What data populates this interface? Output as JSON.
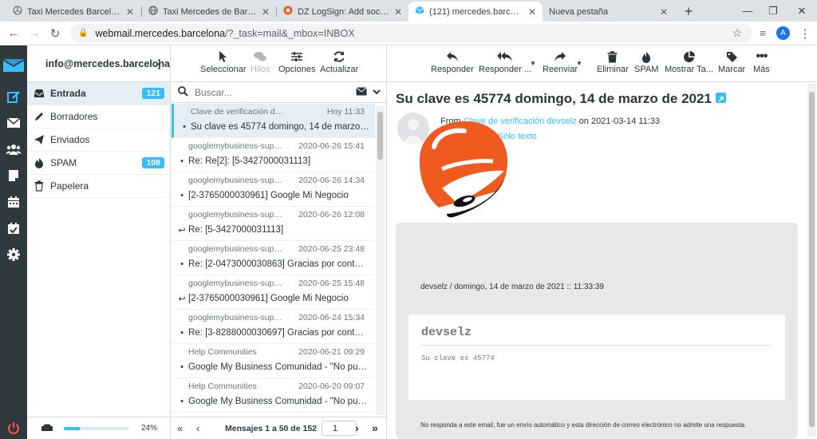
{
  "browser": {
    "tabs": [
      {
        "title": "Taxi Mercedes Barcelona. Te",
        "icon": "mercedes-star"
      },
      {
        "title": "Taxi Mercedes de Barcelona",
        "icon": "globe"
      },
      {
        "title": "DZ LogSign: Add social sign",
        "icon": "dz-logo"
      },
      {
        "title": "(121) mercedes.barcelona W",
        "icon": "roundcube"
      },
      {
        "title": "Nueva pestaña",
        "icon": ""
      }
    ],
    "active_tab": 3,
    "url_host": "webmail.mercedes.barcelona",
    "url_path": "/?_task=mail&_mbox=INBOX",
    "profile_initial": "A"
  },
  "account": {
    "email": "info@mercedes.barcelona"
  },
  "folders": [
    {
      "label": "Entrada",
      "badge": "121",
      "icon": "inbox-icon"
    },
    {
      "label": "Borradores",
      "badge": "",
      "icon": "pencil-icon"
    },
    {
      "label": "Enviados",
      "badge": "",
      "icon": "send-icon"
    },
    {
      "label": "SPAM",
      "badge": "108",
      "icon": "flame-icon"
    },
    {
      "label": "Papelera",
      "badge": "",
      "icon": "trash-icon"
    }
  ],
  "quota": {
    "percent_label": "24%",
    "fraction": 0.24
  },
  "list_toolbar": {
    "select": "Seleccionar",
    "threads": "Hilos",
    "options": "Opciones",
    "refresh": "Actualizar"
  },
  "search": {
    "placeholder": "Buscar..."
  },
  "messages": [
    {
      "from": "Clave de verificación devselz",
      "date": "Hoy 11:33",
      "subject": "Su clave es 45774 domingo, 14 de marzo de 2021",
      "status": "•",
      "selected": true
    },
    {
      "from": "googlemybusiness-support@google.com",
      "date": "2020-06-26 15:41",
      "subject": "Re: Re[2]: [5-3427000031113]",
      "status": "•",
      "selected": false
    },
    {
      "from": "googlemybusiness-support@google.com",
      "date": "2020-06-26 14:34",
      "subject": "[2-3765000030961] Google Mi Negocio",
      "status": "•",
      "selected": false
    },
    {
      "from": "googlemybusiness-support@google.com",
      "date": "2020-06-26 12:08",
      "subject": "Re: [5-3427000031113]",
      "status": "↩",
      "selected": false
    },
    {
      "from": "googlemybusiness-support@google.com",
      "date": "2020-06-25 23:48",
      "subject": "Re: [2-0473000030863] Gracias por contactar",
      "status": "•",
      "selected": false
    },
    {
      "from": "googlemybusiness-support@google.com",
      "date": "2020-06-25 15:48",
      "subject": "[2-3765000030961] Google Mi Negocio",
      "status": "↩",
      "selected": false
    },
    {
      "from": "googlemybusiness-support@google.com",
      "date": "2020-06-24 15:34",
      "subject": "Re: [3-8288000030697] Gracias por contactar",
      "status": "•",
      "selected": false
    },
    {
      "from": "Help Communities",
      "date": "2020-06-21 09:29",
      "subject": "Google My Business Comunidad - \"No puedo",
      "status": "•",
      "selected": false
    },
    {
      "from": "Help Communities",
      "date": "2020-06-20 09:07",
      "subject": "Google My Business Comunidad - \"No puedo",
      "status": "•",
      "selected": false
    }
  ],
  "pager": {
    "label": "Mensajes 1 a 50 de 152",
    "page": "1"
  },
  "reader_toolbar": {
    "reply": "Responder",
    "reply_all": "Responder ...",
    "forward": "Reenviar",
    "delete": "Eliminar",
    "spam": "SPAM",
    "show": "Mostrar Ta...",
    "mark": "Marcar",
    "more": "Más"
  },
  "email": {
    "subject": "Su clave es 45774 domingo, 14 de marzo de 2021",
    "from_prefix": "From",
    "from_name": "Clave de verificación devselz",
    "date_prefix": "on",
    "date": "2021-03-14 11:33",
    "plain_text": "Sólo texto",
    "timestamp_line": "devselz / domingo, 14 de marzo de 2021 :: 11:33:39",
    "card_title": "devselz",
    "card_text": "Su clave es 45774",
    "footer": "No responda a este email, fue un envío automático y esta dirección de correo electrónico no admite una respuesta."
  },
  "colors": {
    "accent": "#37beff",
    "sidebar": "#2f3a3f",
    "logo_orange": "#f05a1f"
  }
}
